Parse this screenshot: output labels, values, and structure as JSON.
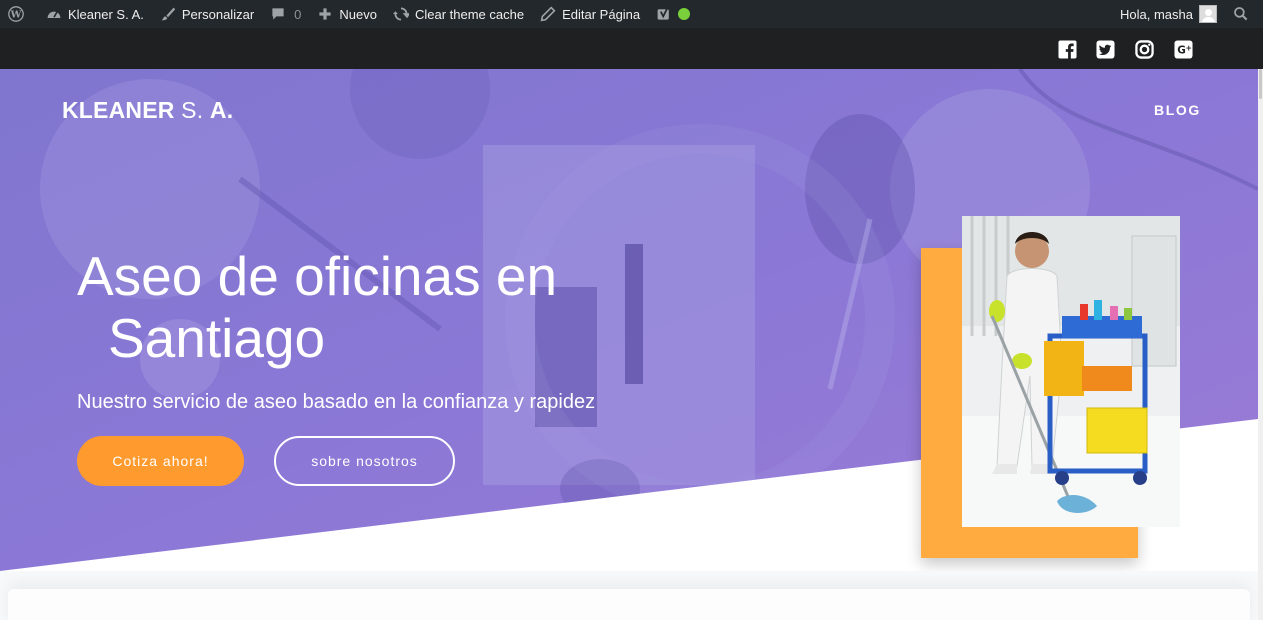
{
  "admin_bar": {
    "site_name": "Kleaner S. A.",
    "customize": "Personalizar",
    "comments_count": "0",
    "new": "Nuevo",
    "clear_cache": "Clear theme cache",
    "edit_page": "Editar Página",
    "greeting": "Hola, masha",
    "status_color": "#7ad03a"
  },
  "social": {
    "icons": [
      "facebook-icon",
      "twitter-icon",
      "instagram-icon",
      "google-plus-icon"
    ]
  },
  "site": {
    "brand_bold": "KLEANER",
    "brand_light": "S.",
    "brand_bold2": "A."
  },
  "nav": {
    "blog": "BLOG"
  },
  "hero": {
    "title_line1": "Aseo de oficinas en",
    "title_line2": "Santiago",
    "subtitle": "Nuestro servicio de aseo basado en la confianza y rapidez",
    "cta_primary": "Cotiza ahora!",
    "cta_secondary": "sobre nosotros",
    "overlay_color": "#8071d6",
    "accent_color": "#ffab40",
    "button_color": "#ff9a2e"
  }
}
